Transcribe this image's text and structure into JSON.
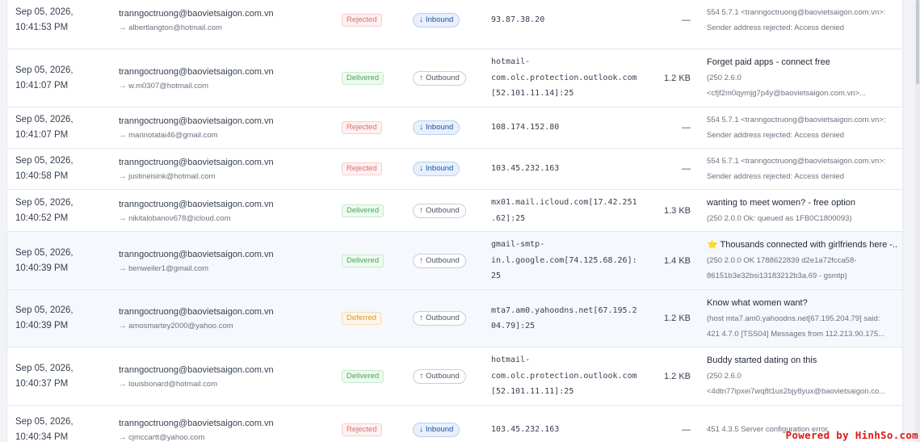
{
  "rows": [
    {
      "date": "Sep 05, 2026,",
      "time": "10:41:53 PM",
      "from": "tranngoctruong@baovietsaigon.com.vn",
      "to": "→ albertlangton@hotmail.com",
      "status": "Rejected",
      "direction": "Inbound",
      "host": [
        "93.87.38.20"
      ],
      "size": "—",
      "subject": "",
      "response": [
        "554 5.7.1 <tranngoctruong@baovietsaigon.com.vn>:",
        "Sender address rejected: Access denied"
      ]
    },
    {
      "date": "Sep 05, 2026,",
      "time": "10:41:07 PM",
      "from": "tranngoctruong@baovietsaigon.com.vn",
      "to": "→ w.m0307@hotmail.com",
      "status": "Delivered",
      "direction": "Outbound",
      "host": [
        "hotmail-",
        "com.olc.protection.outlook.com",
        "[52.101.11.14]:25"
      ],
      "size": "1.2 KB",
      "subject": "Forget paid apps - connect free",
      "response": [
        "(250 2.6.0",
        "<cfjf2m0qymjg7p4y@baovietsaigon.com.vn>..."
      ]
    },
    {
      "date": "Sep 05, 2026,",
      "time": "10:41:07 PM",
      "from": "tranngoctruong@baovietsaigon.com.vn",
      "to": "→ marinotatai46@gmail.com",
      "status": "Rejected",
      "direction": "Inbound",
      "host": [
        "108.174.152.80"
      ],
      "size": "—",
      "subject": "",
      "response": [
        "554 5.7.1 <tranngoctruong@baovietsaigon.com.vn>:",
        "Sender address rejected: Access denied"
      ]
    },
    {
      "date": "Sep 05, 2026,",
      "time": "10:40:58 PM",
      "from": "tranngoctruong@baovietsaigon.com.vn",
      "to": "→ justineisink@hotmail.com",
      "status": "Rejected",
      "direction": "Inbound",
      "host": [
        "103.45.232.163"
      ],
      "size": "—",
      "subject": "",
      "response": [
        "554 5.7.1 <tranngoctruong@baovietsaigon.com.vn>:",
        "Sender address rejected: Access denied"
      ]
    },
    {
      "date": "Sep 05, 2026,",
      "time": "10:40:52 PM",
      "from": "tranngoctruong@baovietsaigon.com.vn",
      "to": "→ nikitalobanov678@icloud.com",
      "status": "Delivered",
      "direction": "Outbound",
      "host": [
        "mx01.mail.icloud.com[17.42.251",
        ".62]:25"
      ],
      "size": "1.3 KB",
      "subject": "wanting to meet women? - free option",
      "response": [
        "(250 2.0.0 Ok: queued as 1FB0C1800093)"
      ]
    },
    {
      "date": "Sep 05, 2026,",
      "time": "10:40:39 PM",
      "from": "tranngoctruong@baovietsaigon.com.vn",
      "to": "→ benweiler1@gmail.com",
      "status": "Delivered",
      "direction": "Outbound",
      "host": [
        "gmail-smtp-",
        "in.l.google.com[74.125.68.26]:",
        "25"
      ],
      "size": "1.4 KB",
      "subject": "⭐ Thousands connected with girlfriends here -...",
      "response": [
        "(250 2.0.0 OK 1788622839 d2e1a72fcca58-",
        "86151b3e32bsi13183212b3a.69 - gsmtp)"
      ]
    },
    {
      "date": "Sep 05, 2026,",
      "time": "10:40:39 PM",
      "from": "tranngoctruong@baovietsaigon.com.vn",
      "to": "→ amosmartey2000@yahoo.com",
      "status": "Deferred",
      "direction": "Outbound",
      "host": [
        "mta7.am0.yahoodns.net[67.195.2",
        "04.79]:25"
      ],
      "size": "1.2 KB",
      "subject": "Know what women want?",
      "response": [
        "(host mta7.am0.yahoodns.net[67.195.204.79] said:",
        "421 4.7.0 [TSS04] Messages from 112.213.90.175..."
      ]
    },
    {
      "date": "Sep 05, 2026,",
      "time": "10:40:37 PM",
      "from": "tranngoctruong@baovietsaigon.com.vn",
      "to": "→ louisbonard@hotmail.com",
      "status": "Delivered",
      "direction": "Outbound",
      "host": [
        "hotmail-",
        "com.olc.protection.outlook.com",
        "[52.101.11.11]:25"
      ],
      "size": "1.2 KB",
      "subject": "Buddy started dating on this",
      "response": [
        "(250 2.6.0",
        "<4dtn77ipxei7wq8t1us2bjy8yux@baovietsaigon.co..."
      ]
    },
    {
      "date": "Sep 05, 2026,",
      "time": "10:40:34 PM",
      "from": "tranngoctruong@baovietsaigon.com.vn",
      "to": "→ cjmccartt@yahoo.com",
      "status": "Rejected",
      "direction": "Inbound",
      "host": [
        "103.45.232.163"
      ],
      "size": "—",
      "subject": "",
      "response": [
        "451 4.3.5 Server configuration error"
      ]
    }
  ],
  "icons": {
    "inbound": "arrow-down-icon",
    "outbound": "arrow-up-icon"
  },
  "colors": {
    "rejected": "#e46a6a",
    "delivered": "#4aa55a",
    "deferred": "#e0962f",
    "inbound": "#1f4fa3"
  },
  "watermark": "Powered by HinhSo.com"
}
